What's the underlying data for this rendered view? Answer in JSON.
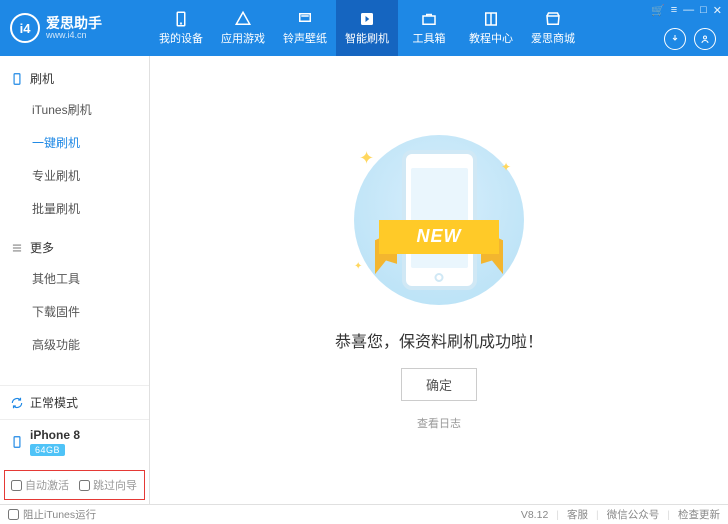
{
  "header": {
    "logo_badge": "i4",
    "logo_title": "爱思助手",
    "logo_url": "www.i4.cn",
    "nav": [
      {
        "label": "我的设备",
        "icon": "phone"
      },
      {
        "label": "应用游戏",
        "icon": "apps"
      },
      {
        "label": "铃声壁纸",
        "icon": "music"
      },
      {
        "label": "智能刷机",
        "icon": "flash",
        "active": true
      },
      {
        "label": "工具箱",
        "icon": "toolbox"
      },
      {
        "label": "教程中心",
        "icon": "book"
      },
      {
        "label": "爱思商城",
        "icon": "shop"
      }
    ]
  },
  "sidebar": {
    "group1": {
      "title": "刷机",
      "items": [
        {
          "label": "iTunes刷机"
        },
        {
          "label": "一键刷机",
          "active": true
        },
        {
          "label": "专业刷机"
        },
        {
          "label": "批量刷机"
        }
      ]
    },
    "group2": {
      "title": "更多",
      "items": [
        {
          "label": "其他工具"
        },
        {
          "label": "下载固件"
        },
        {
          "label": "高级功能"
        }
      ]
    },
    "status_label": "正常模式",
    "device_name": "iPhone 8",
    "device_storage": "64GB",
    "opt_auto_activate": "自动激活",
    "opt_skip_guide": "跳过向导"
  },
  "main": {
    "ribbon_text": "NEW",
    "success_message": "恭喜您，保资料刷机成功啦！",
    "ok_button": "确定",
    "view_log": "查看日志"
  },
  "footer": {
    "block_itunes": "阻止iTunes运行",
    "version": "V8.12",
    "support": "客服",
    "wechat": "微信公众号",
    "check_update": "检查更新"
  }
}
